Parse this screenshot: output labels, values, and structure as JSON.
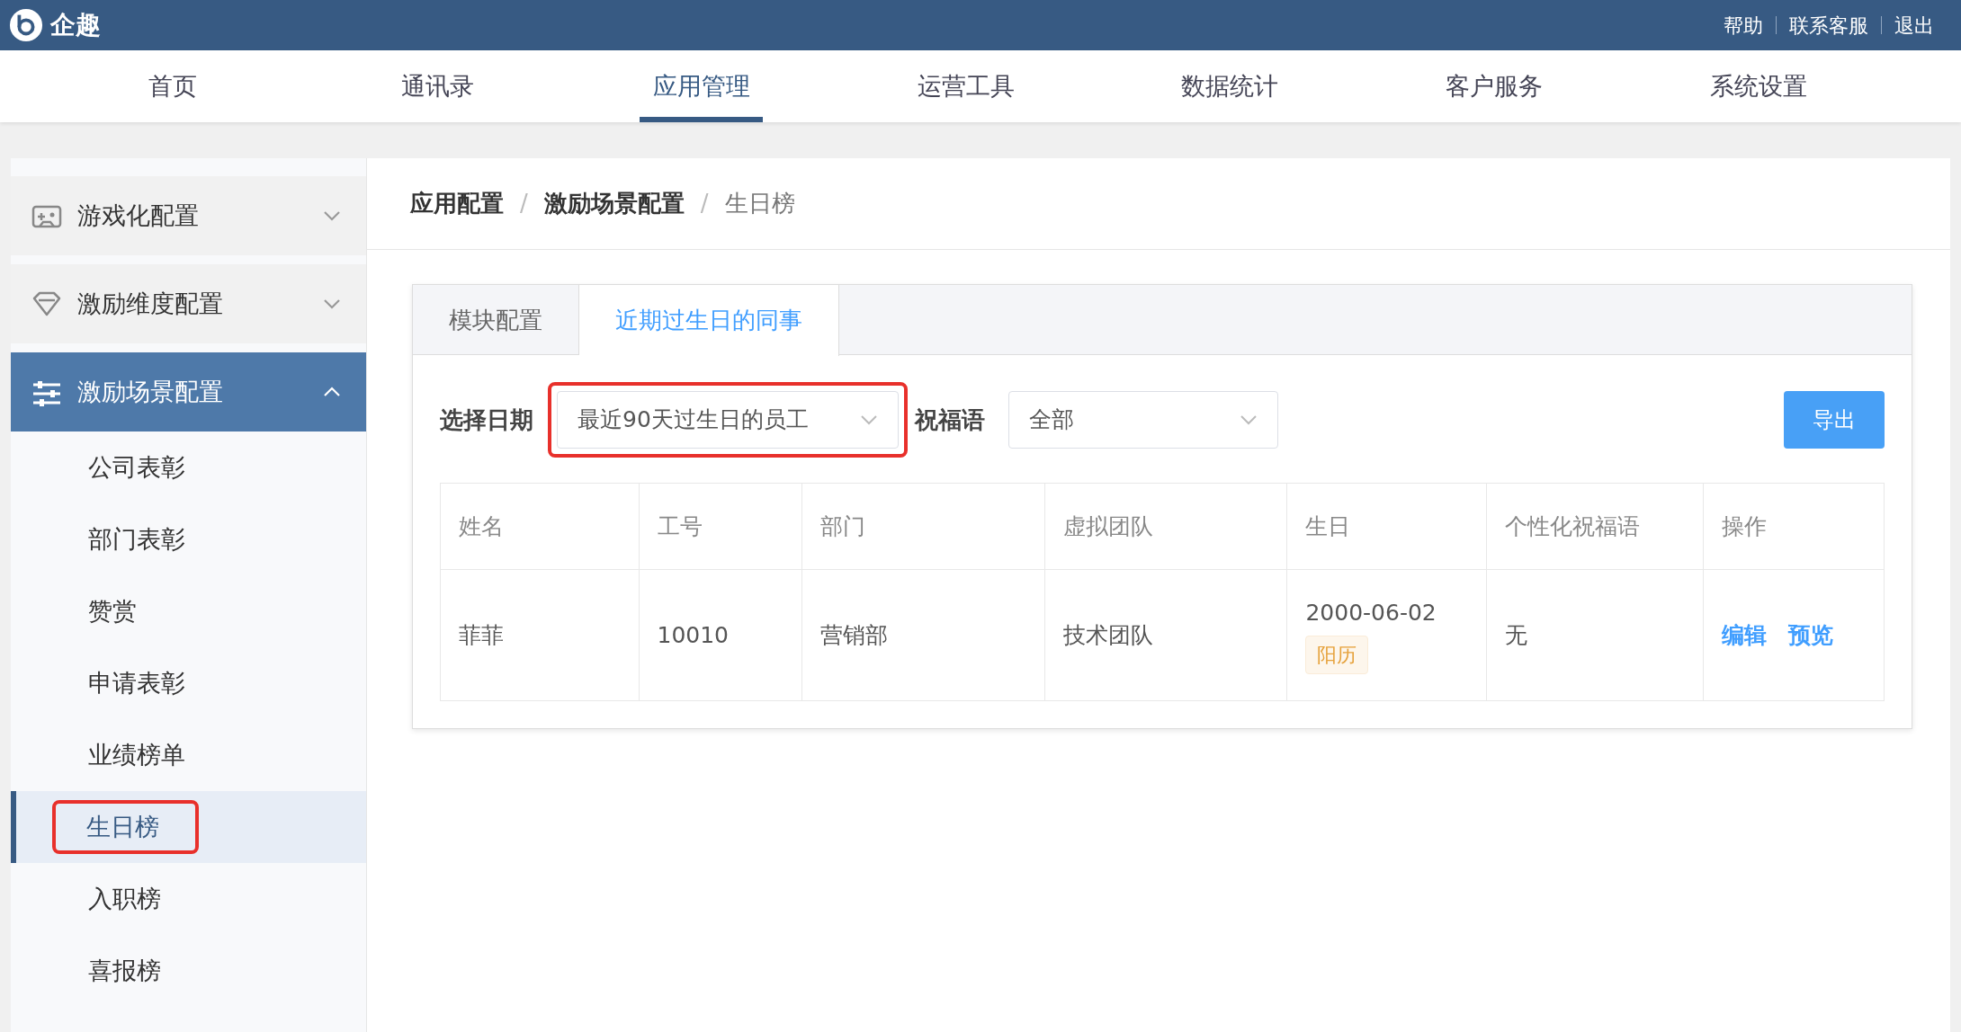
{
  "top_bar": {
    "logo_text": "企趣",
    "links": [
      "帮助",
      "联系客服",
      "退出"
    ]
  },
  "nav": [
    {
      "label": "首页",
      "selected": false
    },
    {
      "label": "通讯录",
      "selected": false
    },
    {
      "label": "应用管理",
      "selected": true
    },
    {
      "label": "运营工具",
      "selected": false
    },
    {
      "label": "数据统计",
      "selected": false
    },
    {
      "label": "客户服务",
      "selected": false
    },
    {
      "label": "系统设置",
      "selected": false
    }
  ],
  "sidebar": {
    "groups": [
      {
        "label": "游戏化配置",
        "expanded": false
      },
      {
        "label": "激励维度配置",
        "expanded": false
      },
      {
        "label": "激励场景配置",
        "expanded": true,
        "children": [
          {
            "label": "公司表彰",
            "selected": false,
            "annotated": false
          },
          {
            "label": "部门表彰",
            "selected": false,
            "annotated": false
          },
          {
            "label": "赞赏",
            "selected": false,
            "annotated": false
          },
          {
            "label": "申请表彰",
            "selected": false,
            "annotated": false
          },
          {
            "label": "业绩榜单",
            "selected": false,
            "annotated": false
          },
          {
            "label": "生日榜",
            "selected": true,
            "annotated": true
          },
          {
            "label": "入职榜",
            "selected": false,
            "annotated": false
          },
          {
            "label": "喜报榜",
            "selected": false,
            "annotated": false
          }
        ]
      }
    ]
  },
  "breadcrumb": [
    {
      "kind": "link",
      "text": "应用配置"
    },
    {
      "kind": "separator",
      "text": "/"
    },
    {
      "kind": "link",
      "text": "激励场景配置"
    },
    {
      "kind": "separator",
      "text": "/"
    },
    {
      "kind": "current",
      "text": "生日榜"
    }
  ],
  "tabs": [
    {
      "label": "模块配置",
      "selected": false
    },
    {
      "label": "近期过生日的同事",
      "selected": true
    }
  ],
  "filters": [
    {
      "label": "选择日期",
      "value": "最近90天过生日的员工",
      "annotated": true
    },
    {
      "label": "祝福语",
      "value": "全部",
      "annotated": false
    }
  ],
  "export_button": "导出",
  "table": {
    "columns": [
      "姓名",
      "工号",
      "部门",
      "虚拟团队",
      "生日",
      "个性化祝福语",
      "操作"
    ],
    "rows": [
      {
        "name": "菲菲",
        "employee_id": "10010",
        "department": "营销部",
        "team": "技术团队",
        "birthday": "2000-06-02",
        "calendar": "阳历",
        "greeting": "无",
        "actions": [
          "编辑",
          "预览"
        ]
      }
    ]
  }
}
